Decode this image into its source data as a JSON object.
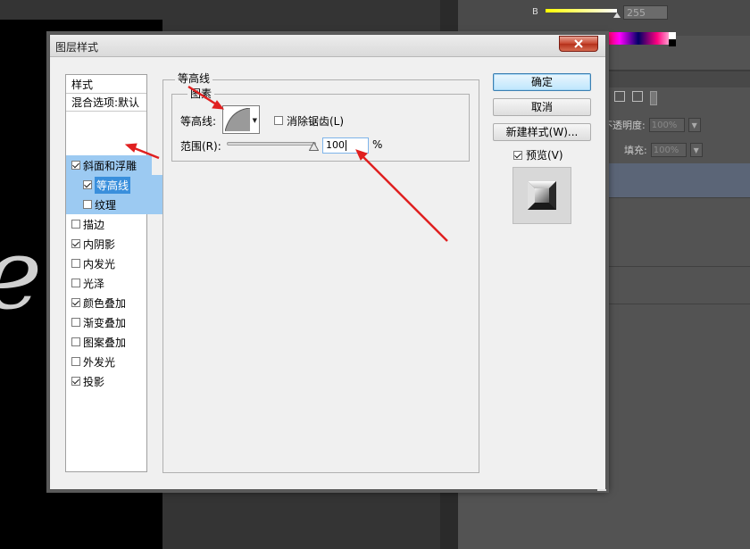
{
  "background": {
    "right_panel": {
      "b_label": "B",
      "b_value": "255",
      "opacity_label": "不透明度:",
      "opacity_value": "100%",
      "fill_label": "填充:",
      "fill_value": "100%",
      "toolbar_text_icon": "T"
    }
  },
  "dialog": {
    "title": "图层样式",
    "styles_header": "样式",
    "blend_options": "混合选项:默认",
    "items": [
      {
        "label": "斜面和浮雕",
        "checked": true
      },
      {
        "label": "等高线",
        "checked": true
      },
      {
        "label": "纹理",
        "checked": false
      },
      {
        "label": "描边",
        "checked": false
      },
      {
        "label": "内阴影",
        "checked": true
      },
      {
        "label": "内发光",
        "checked": false
      },
      {
        "label": "光泽",
        "checked": false
      },
      {
        "label": "颜色叠加",
        "checked": true
      },
      {
        "label": "渐变叠加",
        "checked": false
      },
      {
        "label": "图案叠加",
        "checked": false
      },
      {
        "label": "外发光",
        "checked": false
      },
      {
        "label": "投影",
        "checked": true
      }
    ],
    "contour_panel": {
      "group_title": "等高线",
      "subgroup_title": "图素",
      "contour_label": "等高线:",
      "anti_alias_label": "消除锯齿(L)",
      "anti_alias_checked": false,
      "range_label": "范围(R):",
      "range_value": "100",
      "range_unit": "%",
      "range_fraction": 1.0
    },
    "buttons": {
      "ok": "确定",
      "cancel": "取消",
      "new_style": "新建样式(W)..."
    },
    "preview": {
      "label": "预览(V)",
      "checked": true
    }
  },
  "colors": {
    "annotation_arrow": "#e02020",
    "selection_highlight": "#3a8fdc",
    "section_highlight": "#9ccaf2",
    "close_button": "#c7442d"
  }
}
